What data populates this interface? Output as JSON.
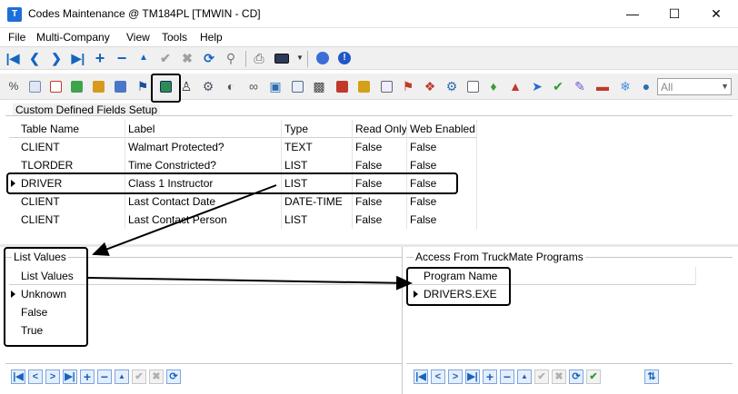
{
  "window": {
    "title": "Codes Maintenance @ TM184PL [TMWIN - CD]",
    "app_icon": "truckmate-icon",
    "controls": [
      "minimize",
      "maximize",
      "close"
    ]
  },
  "menu": {
    "items": [
      "File",
      "Multi-Company",
      "View",
      "Tools",
      "Help"
    ]
  },
  "toolbar2": {
    "filter_value": "All"
  },
  "custom_fields": {
    "caption": "Custom Defined Fields Setup",
    "columns": [
      "Table Name",
      "Label",
      "Type",
      "Read Only",
      "Web Enabled"
    ],
    "rows": [
      {
        "table": "CLIENT",
        "label": "Walmart Protected?",
        "type": "TEXT",
        "read_only": "False",
        "web_enabled": "False"
      },
      {
        "table": "TLORDER",
        "label": "Time Constricted?",
        "type": "LIST",
        "read_only": "False",
        "web_enabled": "False"
      },
      {
        "table": "DRIVER",
        "label": "Class 1 Instructor",
        "type": "LIST",
        "read_only": "False",
        "web_enabled": "False"
      },
      {
        "table": "CLIENT",
        "label": "Last Contact Date",
        "type": "DATE-TIME",
        "read_only": "False",
        "web_enabled": "False"
      },
      {
        "table": "CLIENT",
        "label": "Last Contact Person",
        "type": "LIST",
        "read_only": "False",
        "web_enabled": "False"
      }
    ],
    "selected_row": "DRIVER"
  },
  "list_values": {
    "caption": "List Values",
    "column": "List Values",
    "rows": [
      "Unknown",
      "False",
      "True"
    ],
    "selected_row": "Unknown"
  },
  "access_programs": {
    "caption": "Access From TruckMate Programs",
    "column": "Program Name",
    "rows": [
      "DRIVERS.EXE"
    ],
    "selected_row": "DRIVERS.EXE"
  }
}
